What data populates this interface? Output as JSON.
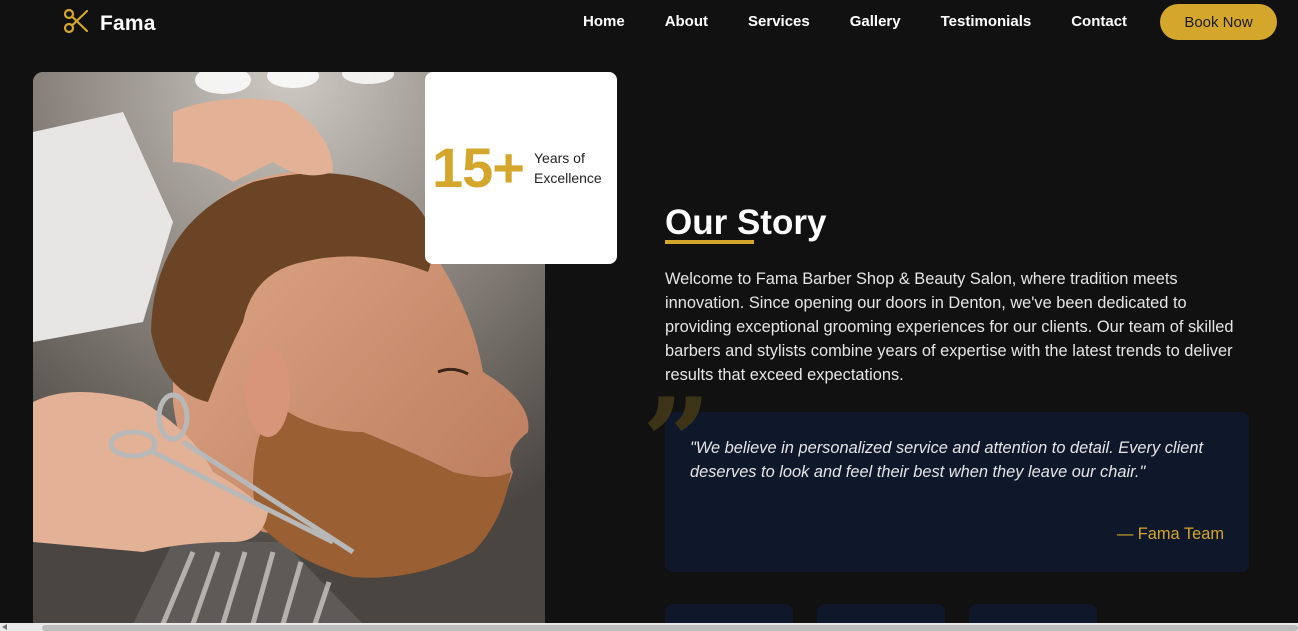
{
  "brand": {
    "name": "Fama",
    "accent": "#d4a72c",
    "icon": "scissors-icon"
  },
  "nav": {
    "links": [
      "Home",
      "About",
      "Services",
      "Gallery",
      "Testimonials",
      "Contact"
    ],
    "cta": "Book Now"
  },
  "badge": {
    "number": "15+",
    "label_line1": "Years of",
    "label_line2": "Excellence"
  },
  "story": {
    "title": "Our Story",
    "body": "Welcome to Fama Barber Shop & Beauty Salon, where tradition meets innovation. Since opening our doors in Denton, we've been dedicated to providing exceptional grooming experiences for our clients. Our team of skilled barbers and stylists combine years of expertise with the latest trends to deliver results that exceed expectations."
  },
  "quote": {
    "text": "\"We believe in personalized service and attention to detail. Every client deserves to look and feel their best when they leave our chair.\"",
    "author": "— Fama Team",
    "icon": "quote-icon"
  },
  "colors": {
    "background": "#111111",
    "card": "#0f172a",
    "accent": "#d4a72c"
  }
}
